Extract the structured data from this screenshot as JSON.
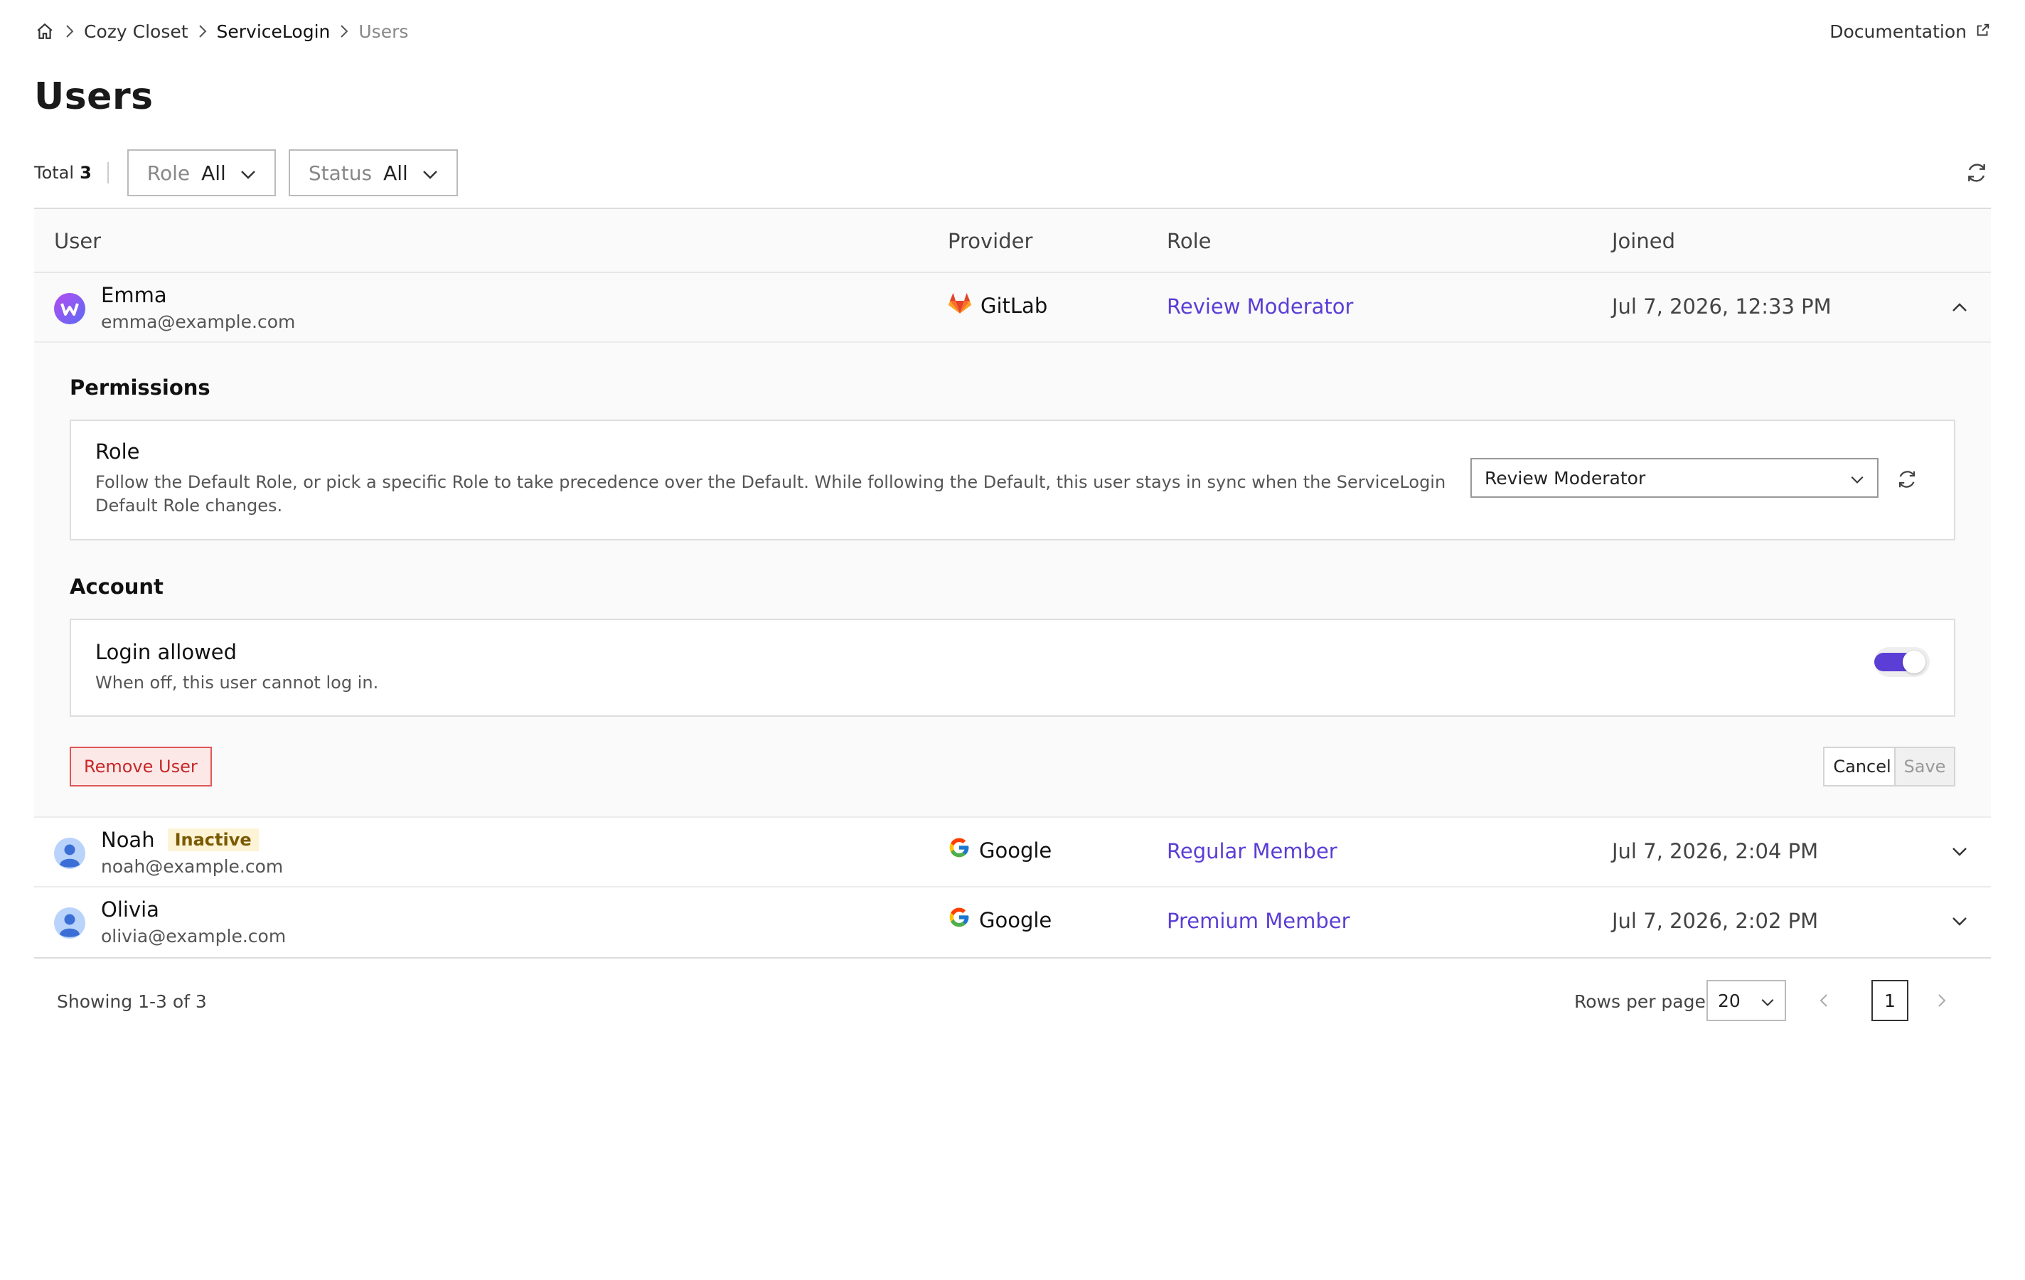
{
  "breadcrumb": {
    "items": [
      "Cozy Closet",
      "ServiceLogin",
      "Users"
    ]
  },
  "header": {
    "documentation_label": "Documentation"
  },
  "page_title": "Users",
  "filters": {
    "total_label": "Total",
    "total_count": "3",
    "role": {
      "label": "Role",
      "value": "All"
    },
    "status": {
      "label": "Status",
      "value": "All"
    }
  },
  "table": {
    "columns": [
      "User",
      "Provider",
      "Role",
      "Joined"
    ],
    "rows": [
      {
        "name": "Emma",
        "email": "emma@example.com",
        "provider": "GitLab",
        "role": "Review Moderator",
        "joined": "Jul 7, 2026, 12:33 PM",
        "expanded": true
      },
      {
        "name": "Noah",
        "badge": "Inactive",
        "email": "noah@example.com",
        "provider": "Google",
        "role": "Regular Member",
        "joined": "Jul 7, 2026, 2:04 PM"
      },
      {
        "name": "Olivia",
        "email": "olivia@example.com",
        "provider": "Google",
        "role": "Premium Member",
        "joined": "Jul 7, 2026, 2:02 PM"
      }
    ]
  },
  "details": {
    "permissions_title": "Permissions",
    "role_card": {
      "title": "Role",
      "description": "Follow the Default Role, or pick a specific Role to take precedence over the Default. While following the Default, this user stays in sync when the ServiceLogin Default Role changes.",
      "selected": "Review Moderator"
    },
    "account_title": "Account",
    "login_card": {
      "title": "Login allowed",
      "description": "When off, this user cannot log in.",
      "enabled": true
    },
    "remove_label": "Remove User",
    "cancel_label": "Cancel",
    "save_label": "Save"
  },
  "pagination": {
    "showing": "Showing 1-3 of 3",
    "rows_per_page_label": "Rows per page",
    "rows_per_page": "20",
    "current_page": "1"
  },
  "colors": {
    "accent": "#5b3ed6",
    "danger": "#c62828",
    "badge_bg": "#fdf3d5"
  },
  "icons": {
    "home": "home-icon",
    "external": "external-link-icon",
    "refresh": "refresh-icon",
    "chevron": "chevron-down-icon",
    "gitlab": "gitlab-logo-icon",
    "google": "google-logo-icon"
  }
}
